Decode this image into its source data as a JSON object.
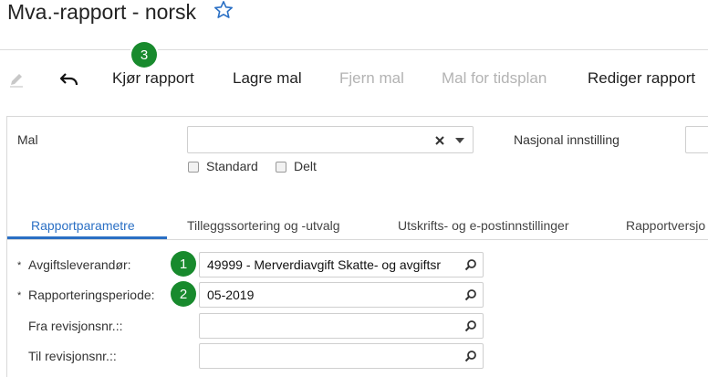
{
  "header": {
    "title": "Mva.-rapport - norsk",
    "favorite_icon": "star-outline-icon"
  },
  "toolbar": {
    "edit_icon": "pencil-icon",
    "undo_icon": "undo-arrow-icon",
    "run_report": "Kjør rapport",
    "save_template": "Lagre mal",
    "remove_template": "Fjern mal",
    "schedule_template": "Mal for tidsplan",
    "edit_report": "Rediger rapport"
  },
  "callouts": {
    "one": "1",
    "two": "2",
    "three": "3"
  },
  "form": {
    "template_label": "Mal",
    "template_value": "",
    "clear_icon": "x-icon",
    "dropdown_icon": "caret-down-icon",
    "standard_label": "Standard",
    "shared_label": "Delt",
    "national_setting_label": "Nasjonal innstilling"
  },
  "tabs": [
    {
      "label": "Rapportparametre",
      "active": true
    },
    {
      "label": "Tilleggssortering og -utvalg",
      "active": false
    },
    {
      "label": "Utskrifts- og e-postinnstillinger",
      "active": false
    },
    {
      "label": "Rapportversjo",
      "active": false
    }
  ],
  "params": [
    {
      "label": "Avgiftsleverandør:",
      "required": true,
      "value": "49999 - Merverdiavgift Skatte- og avgiftsr"
    },
    {
      "label": "Rapporteringsperiode:",
      "required": true,
      "value": "05-2019"
    },
    {
      "label": "Fra revisjonsnr.::",
      "required": false,
      "value": ""
    },
    {
      "label": "Til revisjonsnr.::",
      "required": false,
      "value": ""
    }
  ],
  "required_marker": "*",
  "colors": {
    "accent": "#2a6fc4",
    "badge": "#188a2d"
  }
}
